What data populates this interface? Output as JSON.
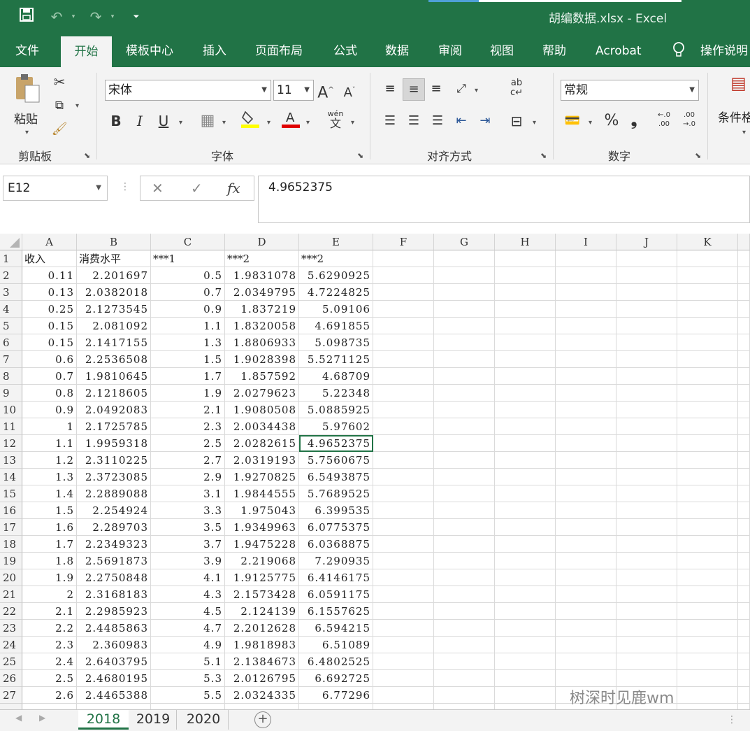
{
  "window": {
    "title": "胡编数据.xlsx  -   Excel",
    "quick_access": [
      "save-icon",
      "undo-icon",
      "redo-icon",
      "customize-icon"
    ]
  },
  "ribbon_tabs": [
    "文件",
    "开始",
    "模板中心",
    "插入",
    "页面布局",
    "公式",
    "数据",
    "审阅",
    "视图",
    "帮助",
    "Acrobat",
    "操作说明"
  ],
  "active_tab": "开始",
  "ribbon": {
    "clipboard": {
      "label": "剪贴板",
      "paste_label": "粘贴"
    },
    "font": {
      "label": "字体",
      "font_name": "宋体",
      "font_size": "11",
      "increase": "A",
      "decrease": "A",
      "bold": "B",
      "italic": "I",
      "underline": "U",
      "phonetic": "wén"
    },
    "alignment": {
      "label": "对齐方式"
    },
    "number": {
      "label": "数字",
      "format": "常规",
      "percent": "%",
      "comma": "❟",
      "inc_decimal": "←.0 .00",
      "dec_decimal": ".00 →.0"
    },
    "styles": {
      "cond_format": "条件格"
    }
  },
  "formula_bar": {
    "name_box": "E12",
    "cancel": "✕",
    "enter": "✓",
    "fx": "fx",
    "value": "4.9652375"
  },
  "columns": [
    "A",
    "B",
    "C",
    "D",
    "E",
    "F",
    "G",
    "H",
    "I",
    "J",
    "K"
  ],
  "rows": [
    [
      "收入",
      "消费水平",
      "***1",
      "***2",
      "***2"
    ],
    [
      "0.11",
      "2.201697",
      "0.5",
      "1.9831078",
      "5.6290925"
    ],
    [
      "0.13",
      "2.0382018",
      "0.7",
      "2.0349795",
      "4.7224825"
    ],
    [
      "0.25",
      "2.1273545",
      "0.9",
      "1.837219",
      "5.09106"
    ],
    [
      "0.15",
      "2.081092",
      "1.1",
      "1.8320058",
      "4.691855"
    ],
    [
      "0.15",
      "2.1417155",
      "1.3",
      "1.8806933",
      "5.098735"
    ],
    [
      "0.6",
      "2.2536508",
      "1.5",
      "1.9028398",
      "5.5271125"
    ],
    [
      "0.7",
      "1.9810645",
      "1.7",
      "1.857592",
      "4.68709"
    ],
    [
      "0.8",
      "2.1218605",
      "1.9",
      "2.0279623",
      "5.22348"
    ],
    [
      "0.9",
      "2.0492083",
      "2.1",
      "1.9080508",
      "5.0885925"
    ],
    [
      "1",
      "2.1725785",
      "2.3",
      "2.0034438",
      "5.97602"
    ],
    [
      "1.1",
      "1.9959318",
      "2.5",
      "2.0282615",
      "4.9652375"
    ],
    [
      "1.2",
      "2.3110225",
      "2.7",
      "2.0319193",
      "5.7560675"
    ],
    [
      "1.3",
      "2.3723085",
      "2.9",
      "1.9270825",
      "6.5493875"
    ],
    [
      "1.4",
      "2.2889088",
      "3.1",
      "1.9844555",
      "5.7689525"
    ],
    [
      "1.5",
      "2.254924",
      "3.3",
      "1.975043",
      "6.399535"
    ],
    [
      "1.6",
      "2.289703",
      "3.5",
      "1.9349963",
      "6.0775375"
    ],
    [
      "1.7",
      "2.2349323",
      "3.7",
      "1.9475228",
      "6.0368875"
    ],
    [
      "1.8",
      "2.5691873",
      "3.9",
      "2.219068",
      "7.290935"
    ],
    [
      "1.9",
      "2.2750848",
      "4.1",
      "1.9125775",
      "6.4146175"
    ],
    [
      "2",
      "2.3168183",
      "4.3",
      "2.1573428",
      "6.0591175"
    ],
    [
      "2.1",
      "2.2985923",
      "4.5",
      "2.124139",
      "6.1557625"
    ],
    [
      "2.2",
      "2.4485863",
      "4.7",
      "2.2012628",
      "6.594215"
    ],
    [
      "2.3",
      "2.360983",
      "4.9",
      "1.9818983",
      "6.51089"
    ],
    [
      "2.4",
      "2.6403795",
      "5.1",
      "2.1384673",
      "6.4802525"
    ],
    [
      "2.5",
      "2.4680195",
      "5.3",
      "2.0126795",
      "6.692725"
    ],
    [
      "2.6",
      "2.4465388",
      "5.5",
      "2.0324335",
      "6.77296"
    ]
  ],
  "sheet_tabs": [
    "2018",
    "2019",
    "2020"
  ],
  "active_sheet": "2018",
  "watermark": "树深时见鹿wm",
  "colors": {
    "accent": "#217346",
    "ribbon_bg": "#f3f3f3"
  }
}
